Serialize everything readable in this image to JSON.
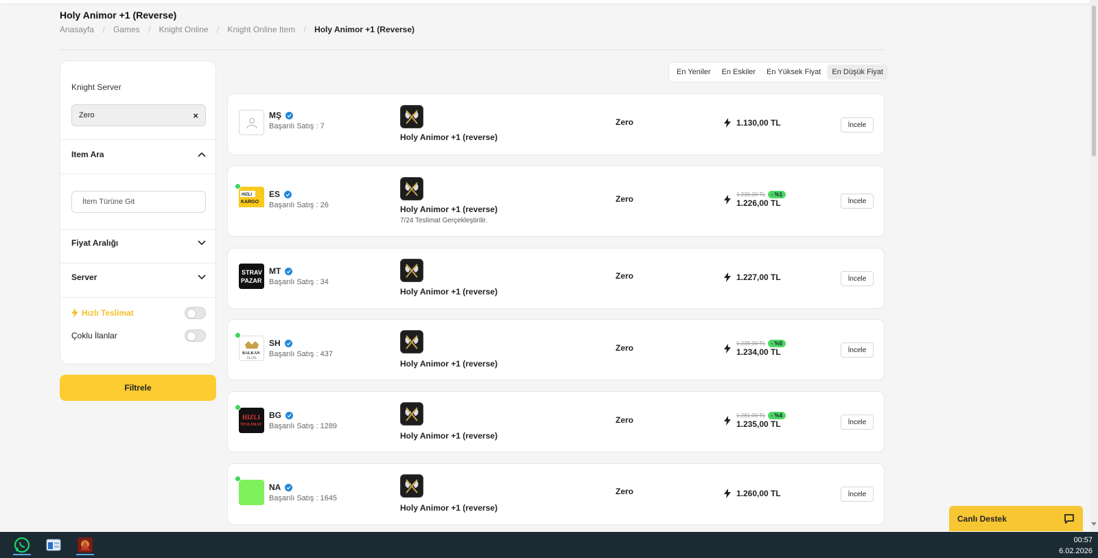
{
  "page": {
    "title": "Holy Animor +1 (Reverse)",
    "breadcrumb": [
      "Anasayfa",
      "Games",
      "Knight Online",
      "Knight Online Item",
      "Holy Animor +1 (Reverse)"
    ]
  },
  "filters": {
    "server_label": "Knight Server",
    "server_chip": "Zero",
    "item_search_heading": "Item Ara",
    "item_search_placeholder": "İtem Türüne Git",
    "price_range_heading": "Fiyat Aralığı",
    "server_heading": "Server",
    "fast_delivery_label": "Hızlı Teslimat",
    "multi_listing_label": "Çoklu İlanlar",
    "filter_button": "Filtrele"
  },
  "sort": {
    "options": [
      "En Yeniler",
      "En Eskiler",
      "En Yüksek Fiyat",
      "En Düşük Fiyat"
    ],
    "active": "En Düşük Fiyat"
  },
  "listings": [
    {
      "seller": "MŞ",
      "sales": "Başarılı Satış : 7",
      "item": "Holy Animor +1 (reverse)",
      "note": "",
      "server": "Zero",
      "old_price": "",
      "discount": "",
      "price": "1.130,00 TL",
      "button": "İncele",
      "online": false,
      "avatar": "placeholder"
    },
    {
      "seller": "ES",
      "sales": "Başarılı Satış : 26",
      "item": "Holy Animor +1 (reverse)",
      "note": "7/24 Teslimat Gerçekleştirilir.",
      "server": "Zero",
      "old_price": "1.236,00 TL",
      "discount": "- %1",
      "price": "1.226,00 TL",
      "button": "İncele",
      "online": true,
      "avatar": "kargo"
    },
    {
      "seller": "MT",
      "sales": "Başarılı Satış : 34",
      "item": "Holy Animor +1 (reverse)",
      "note": "",
      "server": "Zero",
      "old_price": "",
      "discount": "",
      "price": "1.227,00 TL",
      "button": "İncele",
      "online": false,
      "avatar": "strav"
    },
    {
      "seller": "SH",
      "sales": "Başarılı Satış : 437",
      "item": "Holy Animor +1 (reverse)",
      "note": "",
      "server": "Zero",
      "old_price": "1.238,00 TL",
      "discount": "- %0",
      "price": "1.234,00 TL",
      "button": "İncele",
      "online": true,
      "avatar": "balkan"
    },
    {
      "seller": "BG",
      "sales": "Başarılı Satış : 1289",
      "item": "Holy Animor +1 (reverse)",
      "note": "",
      "server": "Zero",
      "old_price": "1.281,00 TL",
      "discount": "- %4",
      "price": "1.235,00 TL",
      "button": "İncele",
      "online": true,
      "avatar": "hizli"
    },
    {
      "seller": "NA",
      "sales": "Başarılı Satış : 1645",
      "item": "Holy Animor +1 (reverse)",
      "note": "",
      "server": "Zero",
      "old_price": "",
      "discount": "",
      "price": "1.260,00 TL",
      "button": "İncele",
      "online": true,
      "avatar": "green"
    }
  ],
  "support": {
    "label": "Canlı Destek"
  },
  "taskbar": {
    "time": "00:57",
    "date": "6.02.2026"
  },
  "colors": {
    "accent_yellow": "#fccc31",
    "verified_blue": "#1f86d9",
    "online_green": "#3ed65a",
    "discount_green": "#4ed664",
    "taskbar": "#1b2a33"
  }
}
